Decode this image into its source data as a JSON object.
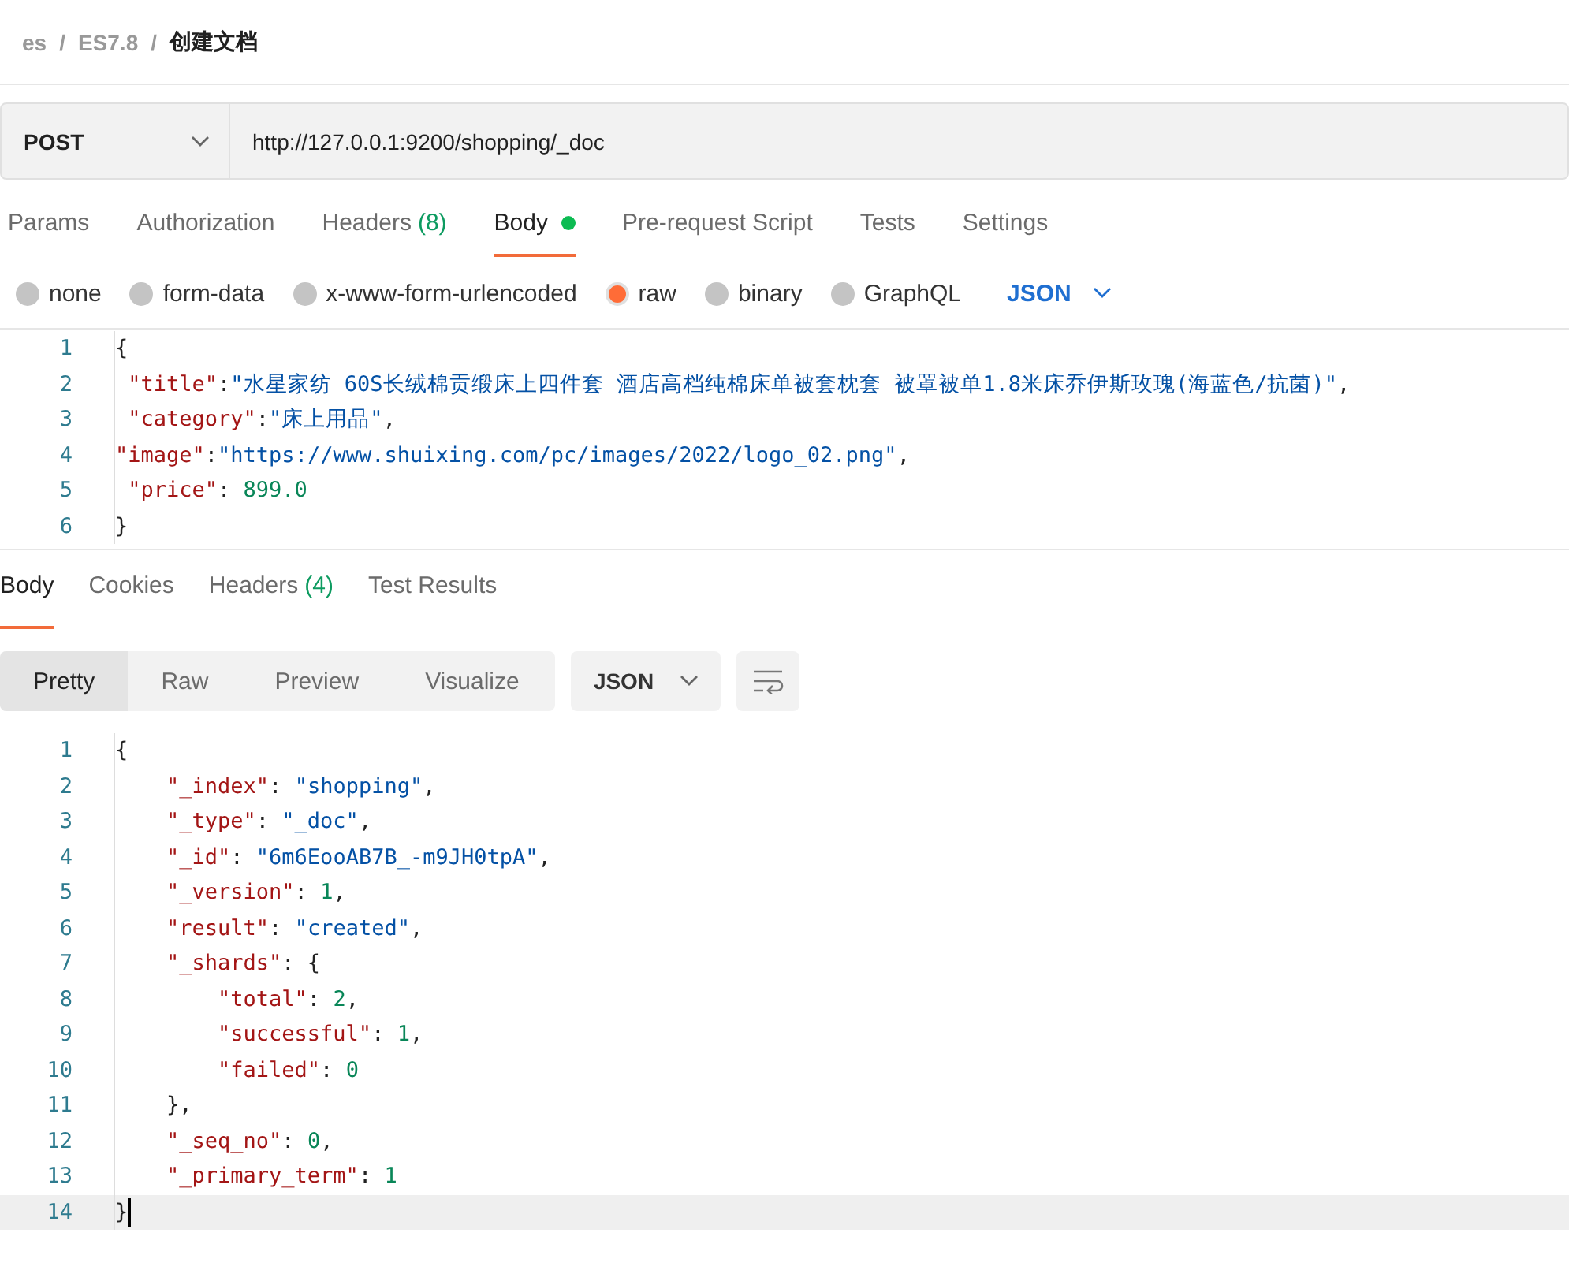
{
  "breadcrumb": {
    "separator": "/",
    "items": [
      "es",
      "ES7.8",
      "创建文档"
    ]
  },
  "request": {
    "method": "POST",
    "url": "http://127.0.0.1:9200/shopping/_doc"
  },
  "request_tabs": [
    {
      "label": "Params",
      "selected": false,
      "dot": false
    },
    {
      "label": "Authorization",
      "selected": false,
      "dot": false
    },
    {
      "label": "Headers",
      "count": "(8)",
      "selected": false,
      "dot": false
    },
    {
      "label": "Body",
      "selected": true,
      "dot": true
    },
    {
      "label": "Pre-request Script",
      "selected": false,
      "dot": false
    },
    {
      "label": "Tests",
      "selected": false,
      "dot": false
    },
    {
      "label": "Settings",
      "selected": false,
      "dot": false
    }
  ],
  "body_types": [
    {
      "label": "none",
      "selected": false
    },
    {
      "label": "form-data",
      "selected": false
    },
    {
      "label": "x-www-form-urlencoded",
      "selected": false
    },
    {
      "label": "raw",
      "selected": true
    },
    {
      "label": "binary",
      "selected": false
    },
    {
      "label": "GraphQL",
      "selected": false
    }
  ],
  "body_format": "JSON",
  "request_body": [
    {
      "number": "1",
      "tokens": [
        {
          "kind": "punct",
          "text": "{"
        }
      ]
    },
    {
      "number": "2",
      "tokens": [
        {
          "kind": "key",
          "text": " \"title\""
        },
        {
          "kind": "punct",
          "text": ":"
        },
        {
          "kind": "str",
          "text": "\"水星家纺 60S长绒棉贡缎床上四件套 酒店高档纯棉床单被套枕套 被罩被单1.8米床乔伊斯玫瑰(海蓝色/抗菌)\""
        },
        {
          "kind": "punct",
          "text": ","
        }
      ]
    },
    {
      "number": "3",
      "tokens": [
        {
          "kind": "key",
          "text": " \"category\""
        },
        {
          "kind": "punct",
          "text": ":"
        },
        {
          "kind": "str",
          "text": "\"床上用品\""
        },
        {
          "kind": "punct",
          "text": ","
        }
      ]
    },
    {
      "number": "4",
      "tokens": [
        {
          "kind": "key",
          "text": "\"image\""
        },
        {
          "kind": "punct",
          "text": ":"
        },
        {
          "kind": "str",
          "text": "\"https://www.shuixing.com/pc/images/2022/logo_02.png\""
        },
        {
          "kind": "punct",
          "text": ","
        }
      ]
    },
    {
      "number": "5",
      "tokens": [
        {
          "kind": "key",
          "text": " \"price\""
        },
        {
          "kind": "punct",
          "text": ": "
        },
        {
          "kind": "num",
          "text": "899.0"
        }
      ]
    },
    {
      "number": "6",
      "tokens": [
        {
          "kind": "punct",
          "text": "}"
        }
      ]
    }
  ],
  "response_tabs": [
    {
      "label": "Body",
      "selected": true
    },
    {
      "label": "Cookies",
      "selected": false
    },
    {
      "label": "Headers",
      "count": "(4)",
      "selected": false
    },
    {
      "label": "Test Results",
      "selected": false
    }
  ],
  "view_modes": [
    {
      "label": "Pretty",
      "selected": true
    },
    {
      "label": "Raw",
      "selected": false
    },
    {
      "label": "Preview",
      "selected": false
    },
    {
      "label": "Visualize",
      "selected": false
    }
  ],
  "response_format": "JSON",
  "response_body": [
    {
      "number": "1",
      "tokens": [
        {
          "kind": "punct",
          "text": "{"
        }
      ]
    },
    {
      "number": "2",
      "tokens": [
        {
          "kind": "key",
          "text": "    \"_index\""
        },
        {
          "kind": "punct",
          "text": ": "
        },
        {
          "kind": "str",
          "text": "\"shopping\""
        },
        {
          "kind": "punct",
          "text": ","
        }
      ]
    },
    {
      "number": "3",
      "tokens": [
        {
          "kind": "key",
          "text": "    \"_type\""
        },
        {
          "kind": "punct",
          "text": ": "
        },
        {
          "kind": "str",
          "text": "\"_doc\""
        },
        {
          "kind": "punct",
          "text": ","
        }
      ]
    },
    {
      "number": "4",
      "tokens": [
        {
          "kind": "key",
          "text": "    \"_id\""
        },
        {
          "kind": "punct",
          "text": ": "
        },
        {
          "kind": "str",
          "text": "\"6m6EooAB7B_-m9JH0tpA\""
        },
        {
          "kind": "punct",
          "text": ","
        }
      ]
    },
    {
      "number": "5",
      "tokens": [
        {
          "kind": "key",
          "text": "    \"_version\""
        },
        {
          "kind": "punct",
          "text": ": "
        },
        {
          "kind": "num",
          "text": "1"
        },
        {
          "kind": "punct",
          "text": ","
        }
      ]
    },
    {
      "number": "6",
      "tokens": [
        {
          "kind": "key",
          "text": "    \"result\""
        },
        {
          "kind": "punct",
          "text": ": "
        },
        {
          "kind": "str",
          "text": "\"created\""
        },
        {
          "kind": "punct",
          "text": ","
        }
      ]
    },
    {
      "number": "7",
      "tokens": [
        {
          "kind": "key",
          "text": "    \"_shards\""
        },
        {
          "kind": "punct",
          "text": ": {"
        }
      ]
    },
    {
      "number": "8",
      "tokens": [
        {
          "kind": "key",
          "text": "        \"total\""
        },
        {
          "kind": "punct",
          "text": ": "
        },
        {
          "kind": "num",
          "text": "2"
        },
        {
          "kind": "punct",
          "text": ","
        }
      ]
    },
    {
      "number": "9",
      "tokens": [
        {
          "kind": "key",
          "text": "        \"successful\""
        },
        {
          "kind": "punct",
          "text": ": "
        },
        {
          "kind": "num",
          "text": "1"
        },
        {
          "kind": "punct",
          "text": ","
        }
      ]
    },
    {
      "number": "10",
      "tokens": [
        {
          "kind": "key",
          "text": "        \"failed\""
        },
        {
          "kind": "punct",
          "text": ": "
        },
        {
          "kind": "num",
          "text": "0"
        }
      ]
    },
    {
      "number": "11",
      "tokens": [
        {
          "kind": "punct",
          "text": "    },"
        }
      ]
    },
    {
      "number": "12",
      "tokens": [
        {
          "kind": "key",
          "text": "    \"_seq_no\""
        },
        {
          "kind": "punct",
          "text": ": "
        },
        {
          "kind": "num",
          "text": "0"
        },
        {
          "kind": "punct",
          "text": ","
        }
      ]
    },
    {
      "number": "13",
      "tokens": [
        {
          "kind": "key",
          "text": "    \"_primary_term\""
        },
        {
          "kind": "punct",
          "text": ": "
        },
        {
          "kind": "num",
          "text": "1"
        }
      ]
    },
    {
      "number": "14",
      "tokens": [
        {
          "kind": "punct",
          "text": "}"
        }
      ],
      "current": true
    }
  ]
}
